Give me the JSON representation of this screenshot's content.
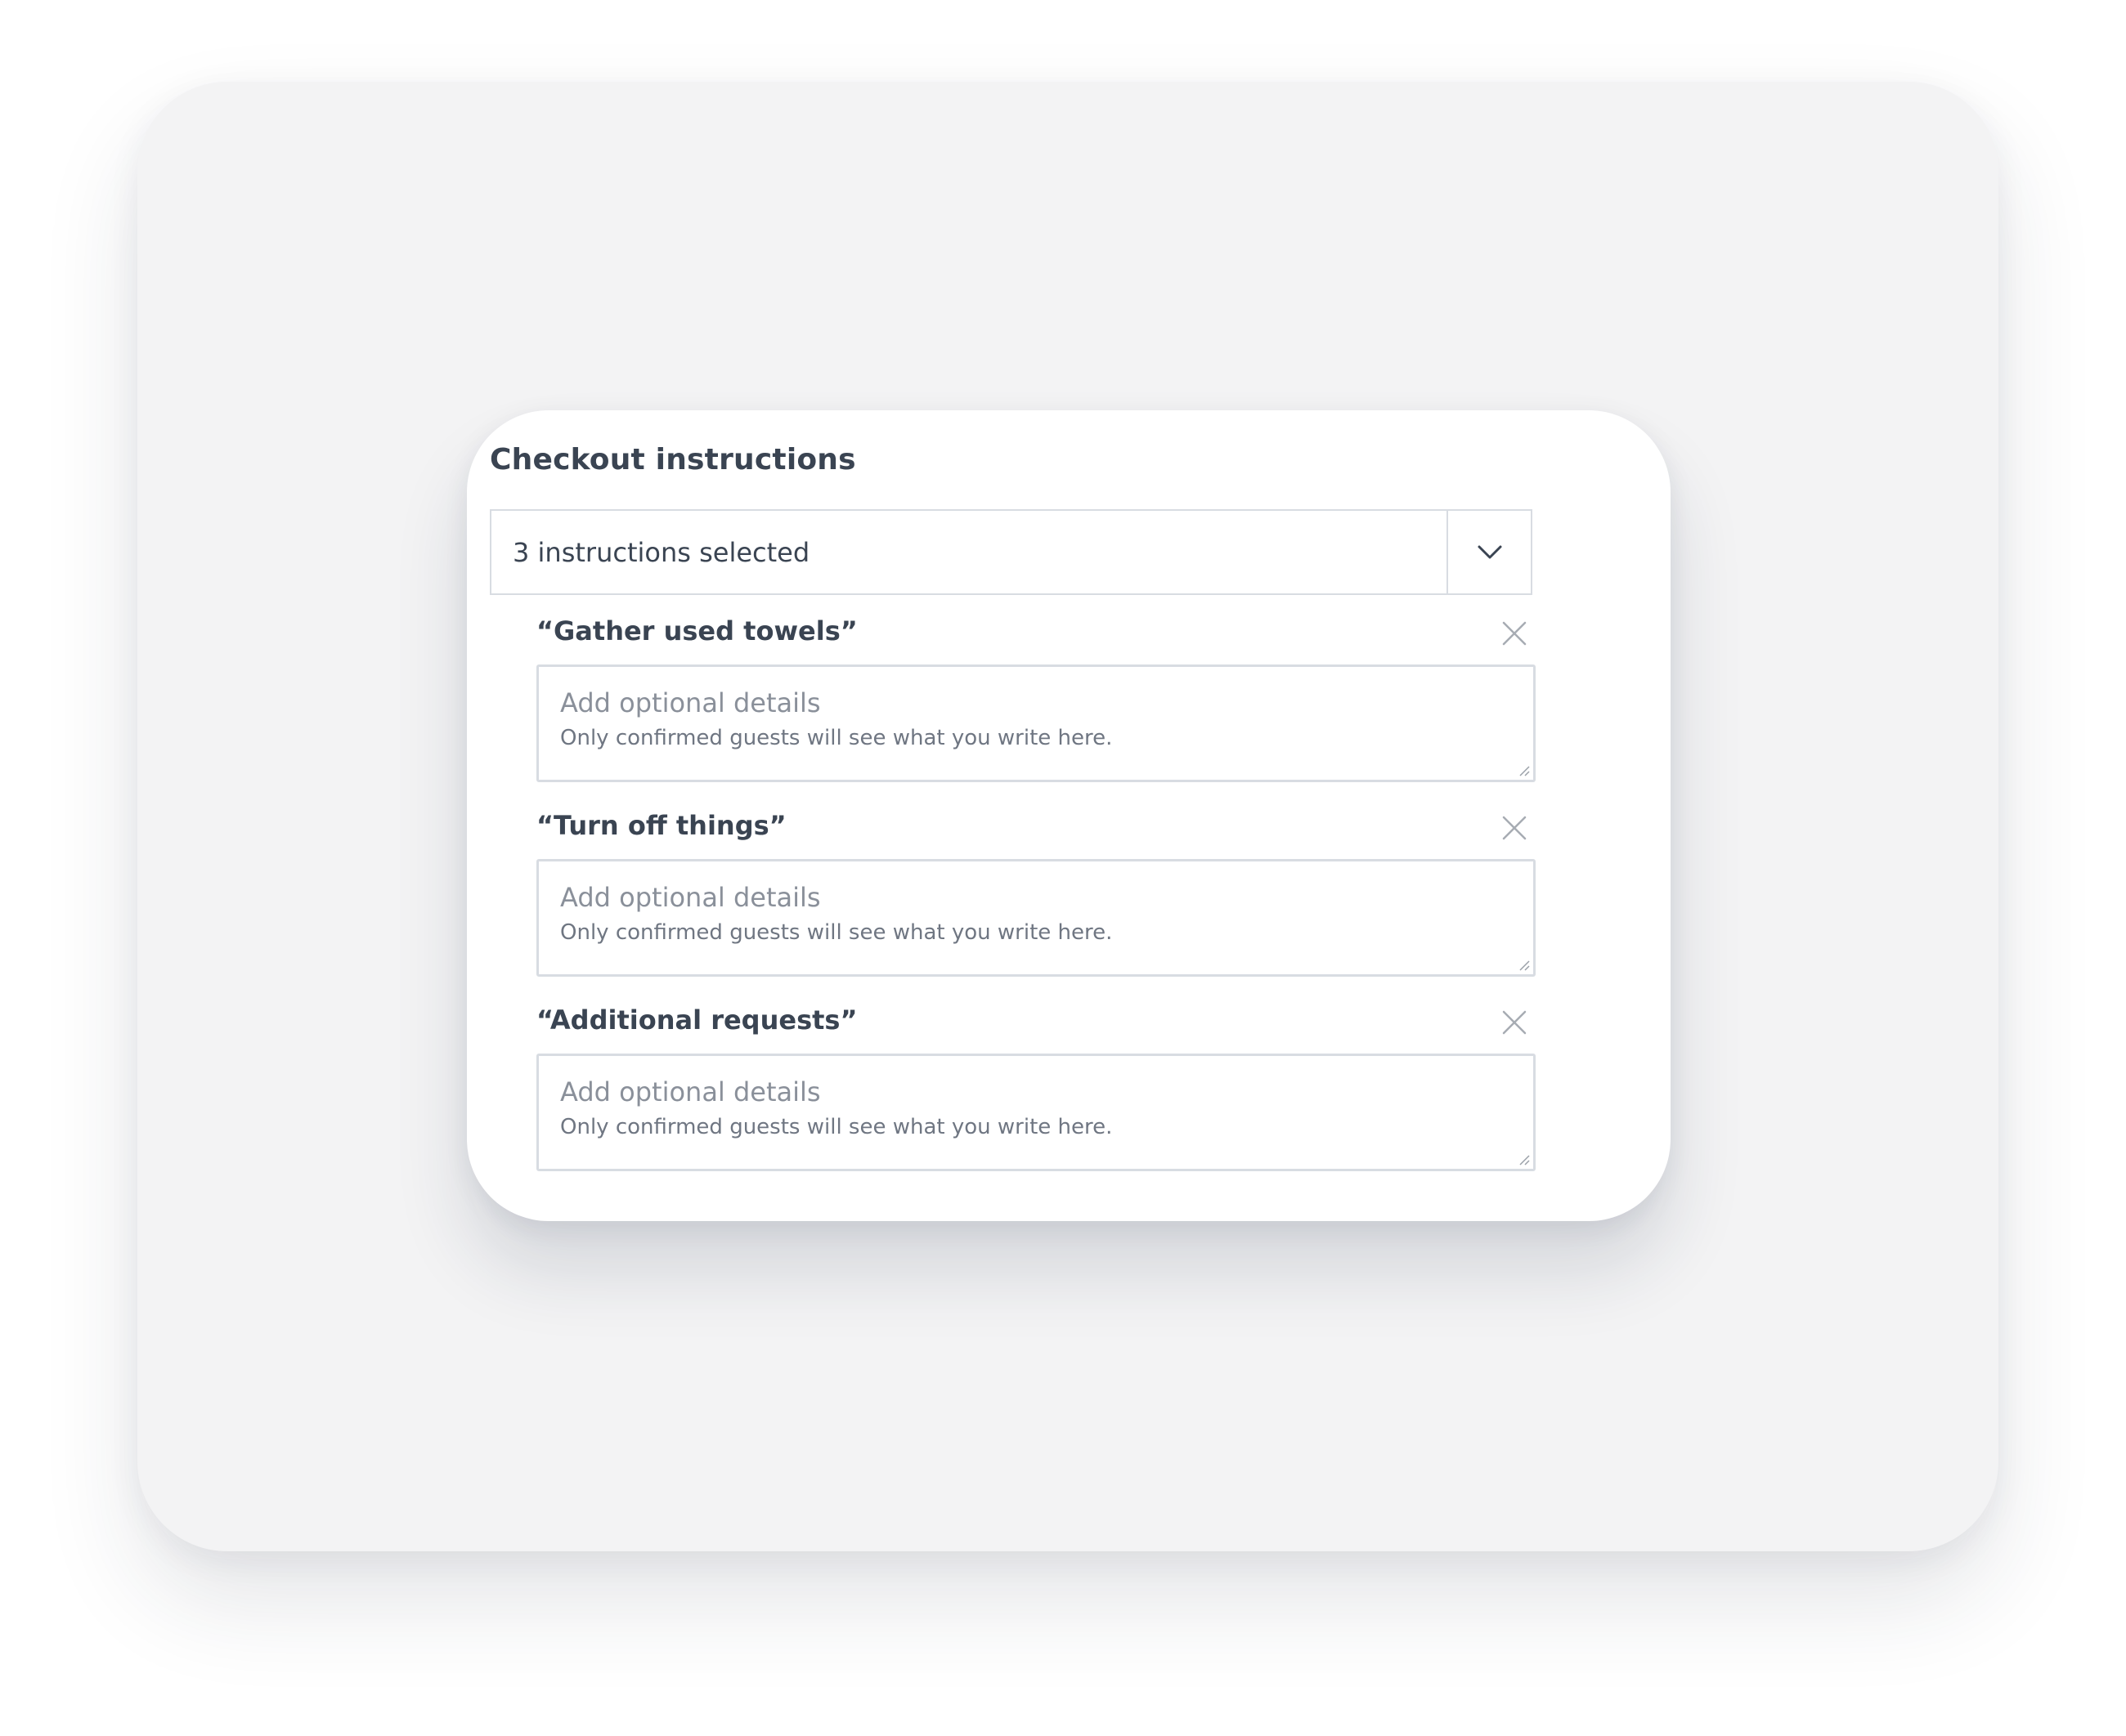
{
  "card": {
    "title": "Checkout instructions"
  },
  "select": {
    "value": "3 instructions selected",
    "toggle_icon": "chevron-down-icon"
  },
  "instructions": [
    {
      "label": "“Gather used towels”",
      "placeholder": "Add optional details",
      "hint": "Only confirmed guests will see what you write here."
    },
    {
      "label": "“Turn off things”",
      "placeholder": "Add optional details",
      "hint": "Only confirmed guests will see what you write here."
    },
    {
      "label": "“Additional requests”",
      "placeholder": "Add optional details",
      "hint": "Only confirmed guests will see what you write here."
    }
  ],
  "icons": {
    "remove": "close-icon",
    "resize": "resize-grip-icon"
  },
  "colors": {
    "text": "#3a4452",
    "placeholder": "#8a909a",
    "border": "#d8dce2",
    "backdrop": "#f3f3f4",
    "card": "#ffffff"
  }
}
